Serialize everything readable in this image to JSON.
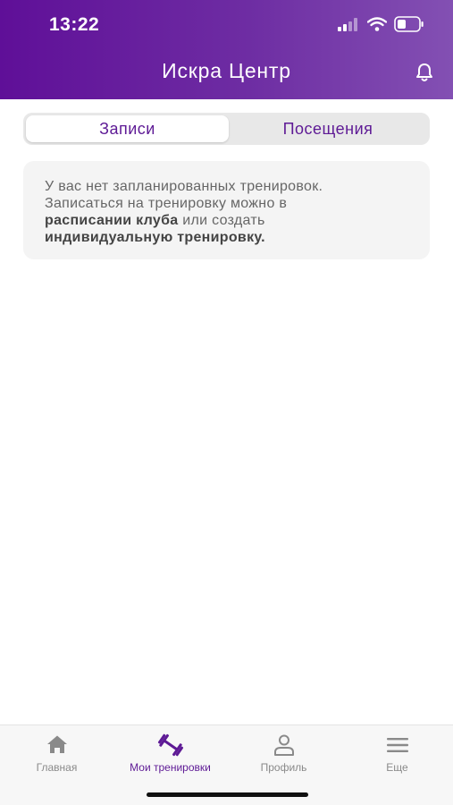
{
  "status_bar": {
    "time": "13:22"
  },
  "header": {
    "title": "Искра Центр"
  },
  "segments": [
    {
      "label": "Записи",
      "active": true
    },
    {
      "label": "Посещения",
      "active": false
    }
  ],
  "info_card": {
    "line1": "У вас нет запланированных тренировок.",
    "line2": "Записаться на тренировку можно в",
    "link1": "расписании клуба",
    "line3_rest": " или создать",
    "link2": "индивидуальную тренировку."
  },
  "tabbar": {
    "tabs": [
      {
        "label": "Главная",
        "icon": "home-icon"
      },
      {
        "label": "Мои тренировки",
        "icon": "dumbbell-icon",
        "active": true
      },
      {
        "label": "Профиль",
        "icon": "profile-icon"
      },
      {
        "label": "Еще",
        "icon": "menu-icon"
      }
    ]
  },
  "colors": {
    "header_gradient_start": "#5f0f98",
    "header_gradient_end": "#8350b3",
    "accent": "#5e1a95",
    "inactive_tab": "#8a8a8a"
  }
}
